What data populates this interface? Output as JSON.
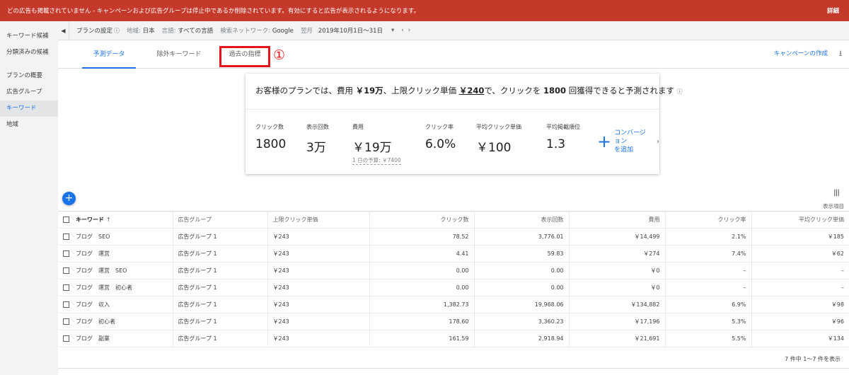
{
  "alert": {
    "message": "どの広告も掲載されていません - キャンペーンおよび広告グループは停止中であるか削除されています。有効にすると広告が表示されるようになります。",
    "detail": "詳細"
  },
  "sidebar": {
    "items": [
      {
        "label": "キーワード候補"
      },
      {
        "label": "分類済みの候補"
      },
      {
        "label": "プランの概要"
      },
      {
        "label": "広告グループ"
      },
      {
        "label": "キーワード"
      },
      {
        "label": "地域"
      }
    ]
  },
  "settings": {
    "plan_settings": "プランの設定",
    "info": "ⓘ",
    "region_label": "地域:",
    "region_value": "日本",
    "language_label": "言語:",
    "language_value": "すべての言語",
    "network_label": "検索ネットワーク:",
    "network_value": "Google",
    "period_label": "翌月",
    "period_value": "2019年10月1日～31日"
  },
  "tabs": [
    {
      "label": "予測データ"
    },
    {
      "label": "除外キーワード"
    },
    {
      "label": "過去の指標"
    }
  ],
  "annotation_marker": "①",
  "actions": {
    "create_campaign": "キャンペーンの作成"
  },
  "forecast": {
    "headline_prefix": "お客様のプランでは、費用 ",
    "cost": "￥19万",
    "headline_mid1": "、上限クリック単価 ",
    "max_cpc": "￥240",
    "headline_mid2": "で、クリックを ",
    "clicks": "1800",
    "headline_suffix": " 回獲得できると予測されます",
    "info": "ⓘ",
    "metrics": [
      {
        "label": "クリック数",
        "value": "1800"
      },
      {
        "label": "表示回数",
        "value": "3万"
      },
      {
        "label": "費用",
        "value": "￥19万",
        "sub": "1 日の予算: ￥7400"
      },
      {
        "label": "クリック率",
        "value": "6.0%"
      },
      {
        "label": "平均クリック単価",
        "value": "￥100"
      },
      {
        "label": "平均掲載順位",
        "value": "1.3"
      }
    ],
    "conversion_line1": "コンバージョン",
    "conversion_line2": "を追加"
  },
  "table": {
    "columns_label": "表示項目",
    "headers": {
      "keyword": "キーワード",
      "sort": "↑",
      "ad_group": "広告グループ",
      "max_cpc": "上限クリック単価",
      "clicks": "クリック数",
      "impressions": "表示回数",
      "cost": "費用",
      "ctr": "クリック率",
      "avg_cpc": "平均クリック単価"
    },
    "rows": [
      {
        "keyword": "ブログ　SEO",
        "ad_group": "広告グループ 1",
        "max_cpc": "￥243",
        "clicks": "78.52",
        "impressions": "3,776.01",
        "cost": "￥14,499",
        "ctr": "2.1%",
        "avg_cpc": "￥185"
      },
      {
        "keyword": "ブログ　運営",
        "ad_group": "広告グループ 1",
        "max_cpc": "￥243",
        "clicks": "4.41",
        "impressions": "59.83",
        "cost": "￥274",
        "ctr": "7.4%",
        "avg_cpc": "￥62"
      },
      {
        "keyword": "ブログ　運営　SEO",
        "ad_group": "広告グループ 1",
        "max_cpc": "￥243",
        "clicks": "0.00",
        "impressions": "0.00",
        "cost": "￥0",
        "ctr": "–",
        "avg_cpc": "–"
      },
      {
        "keyword": "ブログ　運営　初心者",
        "ad_group": "広告グループ 1",
        "max_cpc": "￥243",
        "clicks": "0.00",
        "impressions": "0.00",
        "cost": "￥0",
        "ctr": "–",
        "avg_cpc": "–"
      },
      {
        "keyword": "ブログ　収入",
        "ad_group": "広告グループ 1",
        "max_cpc": "￥243",
        "clicks": "1,382.73",
        "impressions": "19,968.06",
        "cost": "￥134,882",
        "ctr": "6.9%",
        "avg_cpc": "￥98"
      },
      {
        "keyword": "ブログ　初心者",
        "ad_group": "広告グループ 1",
        "max_cpc": "￥243",
        "clicks": "178.60",
        "impressions": "3,360.23",
        "cost": "￥17,196",
        "ctr": "5.3%",
        "avg_cpc": "￥96"
      },
      {
        "keyword": "ブログ　副業",
        "ad_group": "広告グループ 1",
        "max_cpc": "￥243",
        "clicks": "161.59",
        "impressions": "2,918.94",
        "cost": "￥21,691",
        "ctr": "5.5%",
        "avg_cpc": "￥134"
      }
    ],
    "pagination": "7 件中 1～7 件を表示"
  },
  "colors": {
    "alert_bg": "#c5392b",
    "accent": "#1a73e8",
    "highlight": "#e3141b"
  }
}
